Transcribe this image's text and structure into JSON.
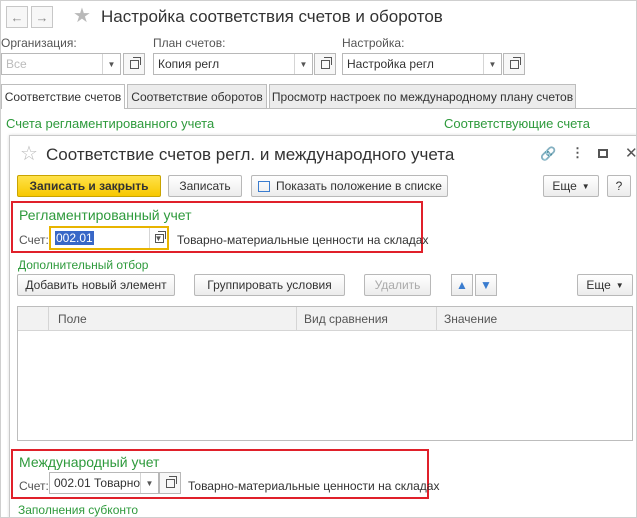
{
  "header": {
    "back_icon": "arrow-left-icon",
    "forward_icon": "arrow-right-icon",
    "favorite_icon": "star-icon",
    "title": "Настройка соответствия счетов и оборотов"
  },
  "filters": {
    "org_label": "Организация:",
    "org_value": "Все",
    "plan_label": "План счетов:",
    "plan_value": "Копия регл",
    "setting_label": "Настройка:",
    "setting_value": "Настройка регл"
  },
  "tabs": [
    {
      "label": "Соответствие счетов",
      "active": true
    },
    {
      "label": "Соответствие оборотов",
      "active": false
    },
    {
      "label": "Просмотр настроек по международному плану счетов",
      "active": false
    }
  ],
  "section": {
    "left_title": "Счета регламентированного учета",
    "right_title": "Соответствующие счета"
  },
  "dialog": {
    "title": "Соответствие счетов регл. и международного учета",
    "icons": [
      "link-icon",
      "more-icon",
      "maximize-icon",
      "close-icon"
    ],
    "toolbar": {
      "save_close": "Записать и закрыть",
      "save": "Записать",
      "show_in_list": "Показать положение в списке",
      "more": "Еще",
      "help": "?"
    },
    "regl": {
      "group_title": "Регламентированный учет",
      "account_label": "Счет:",
      "account_value": "002.01",
      "account_name": "Товарно-материальные ценности на складах"
    },
    "filter_title": "Дополнительный отбор",
    "filter_toolbar": {
      "add": "Добавить новый элемент",
      "group": "Группировать условия",
      "delete": "Удалить",
      "more": "Еще"
    },
    "table": {
      "columns": [
        "Поле",
        "Вид сравнения",
        "Значение"
      ],
      "rows": []
    },
    "intl": {
      "group_title": "Международный учет",
      "account_label": "Счет:",
      "account_value": "002.01 Товарно-",
      "account_name": "Товарно-материальные ценности на складах"
    },
    "subconto_title": "Заполнения субконто"
  },
  "colors": {
    "accent_green": "#2e9a3c",
    "highlight_red": "#e0202a",
    "primary_yellow": "#f7c800"
  }
}
